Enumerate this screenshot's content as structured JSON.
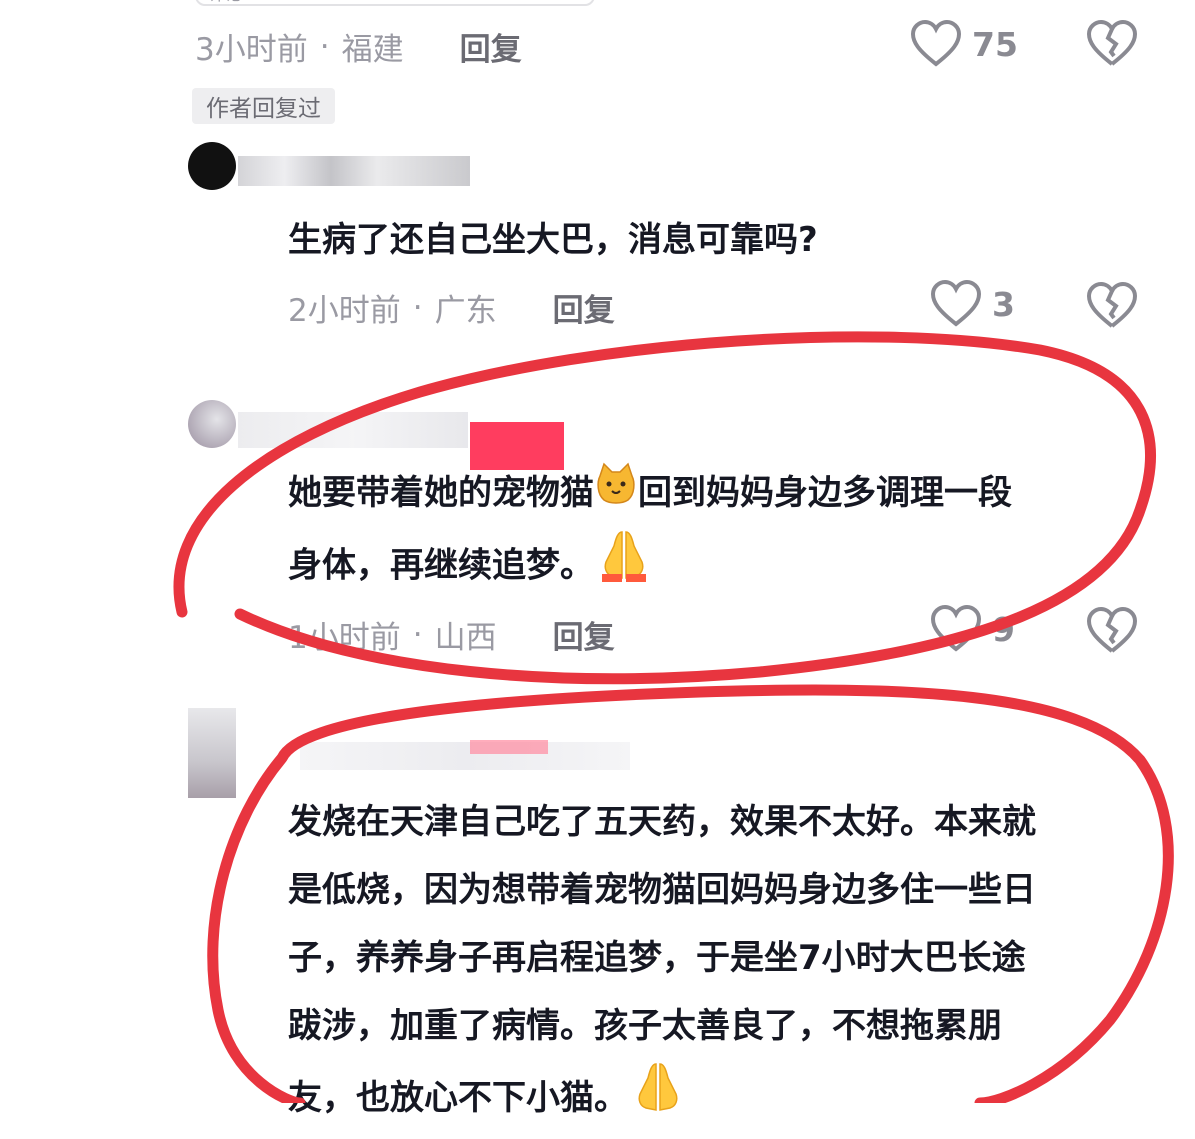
{
  "top_fragment": "评论",
  "comments": [
    {
      "meta_time": "3小时前",
      "meta_location": "福建",
      "reply_label": "回复",
      "like_count": "75",
      "author_tag": "作者回复过"
    },
    {
      "text": "生病了还自己坐大巴，消息可靠吗?",
      "meta_time": "2小时前",
      "meta_location": "广东",
      "reply_label": "回复",
      "like_count": "3"
    },
    {
      "text_line1_a": "她要带着她的宠物猫",
      "text_line1_b": "回到妈妈身边多调理一段",
      "text_line2": "身体，再继续追梦。",
      "meta_time": "1小时前",
      "meta_location": "山西",
      "reply_label": "回复",
      "like_count": "9"
    },
    {
      "lines": [
        "发烧在天津自己吃了五天药，效果不太好。本来就",
        "是低烧，因为想带着宠物猫回妈妈身边多住一些日",
        "子，养养身子再启程追梦，于是坐7小时大巴长途",
        "跋涉，加重了病情。孩子太善良了，不想拖累朋",
        "友，也放心不下小猫。"
      ]
    }
  ],
  "annotation_color": "#e8353f",
  "icons": {
    "like": "heart-outline-icon",
    "dislike": "broken-heart-icon",
    "cat_emoji": "cat-face-emoji",
    "pray_emoji": "folded-hands-emoji"
  }
}
